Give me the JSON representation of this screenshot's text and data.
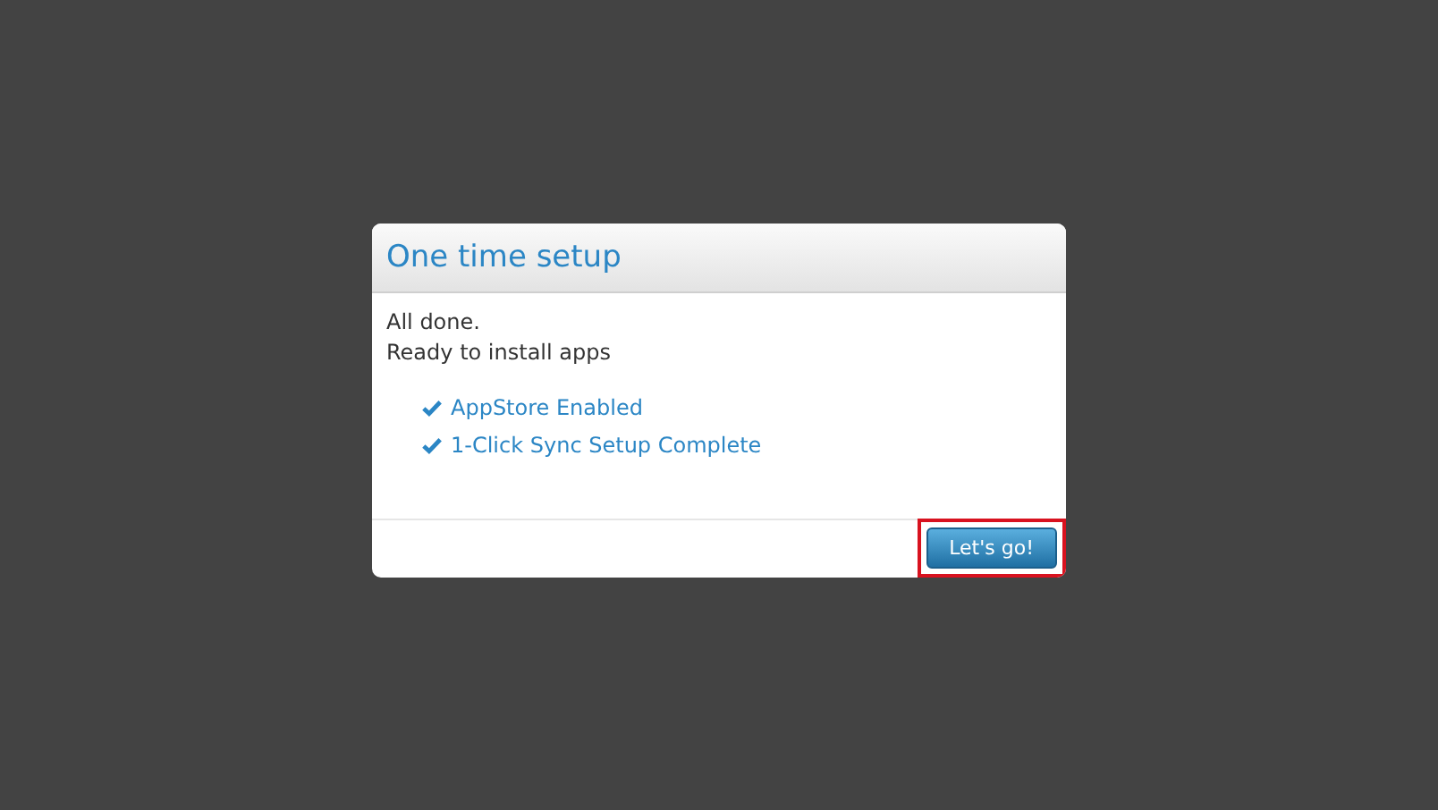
{
  "dialog": {
    "title": "One time setup",
    "message_lines": [
      "All done.",
      "Ready to install apps"
    ],
    "items": [
      {
        "label": "AppStore Enabled",
        "checked": true
      },
      {
        "label": "1-Click Sync Setup Complete",
        "checked": true
      }
    ],
    "button": {
      "label": "Let's go!",
      "highlighted": true
    }
  }
}
